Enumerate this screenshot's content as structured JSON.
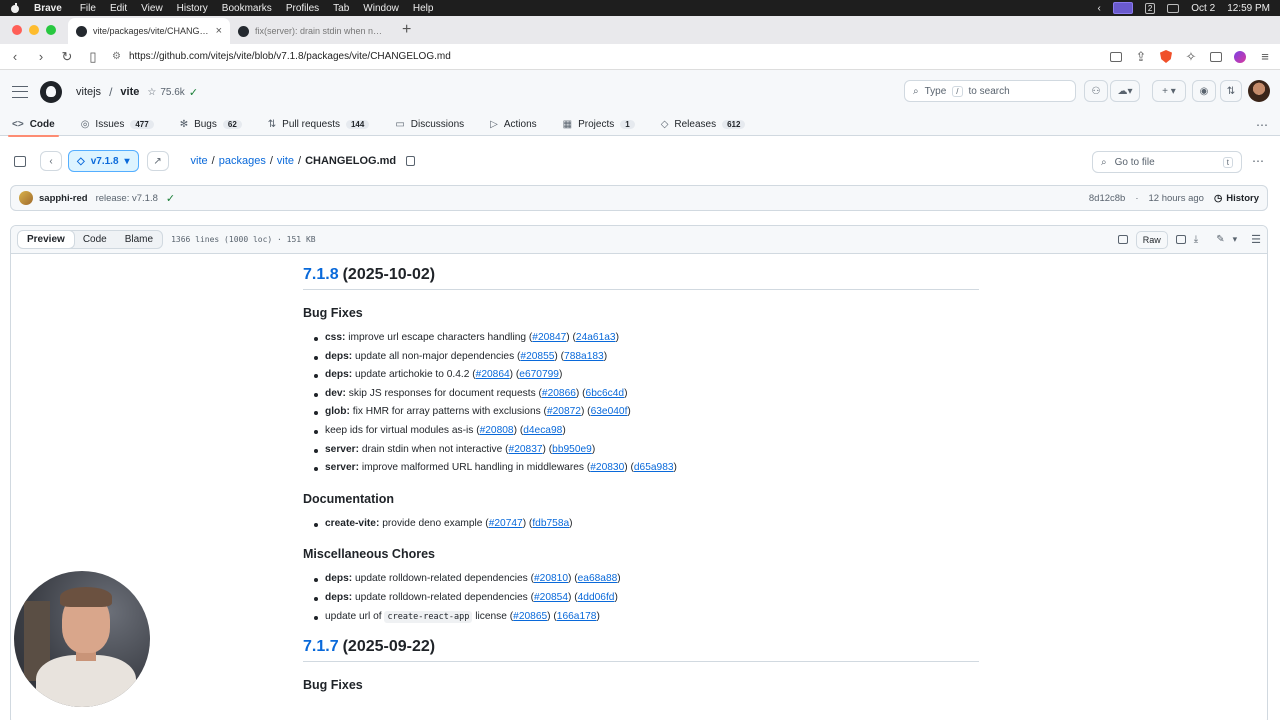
{
  "os": {
    "menubar": [
      "Brave",
      "File",
      "Edit",
      "View",
      "History",
      "Bookmarks",
      "Profiles",
      "Tab",
      "Window",
      "Help"
    ],
    "date": "Oct 2",
    "time": "12:59 PM",
    "desktop_number": "2"
  },
  "browser": {
    "tabs": [
      {
        "title": "vite/packages/vite/CHANGELOG.md"
      },
      {
        "title": "fix(server): drain stdin when not interactive"
      }
    ],
    "url": "https://github.com/vitejs/vite/blob/v7.1.8/packages/vite/CHANGELOG.md"
  },
  "github": {
    "owner": "vitejs",
    "repo": "vite",
    "stars": "75.6k",
    "search_placeholder_pre": "Type",
    "search_key": "/",
    "search_placeholder_post": "to search",
    "nav": [
      {
        "label": "Code",
        "count": ""
      },
      {
        "label": "Issues",
        "count": "477"
      },
      {
        "label": "Bugs",
        "count": "62"
      },
      {
        "label": "Pull requests",
        "count": "144"
      },
      {
        "label": "Discussions",
        "count": ""
      },
      {
        "label": "Actions",
        "count": ""
      },
      {
        "label": "Projects",
        "count": "1"
      },
      {
        "label": "Releases",
        "count": "612"
      }
    ],
    "branch": "v7.1.8",
    "path": [
      "vite",
      "packages",
      "vite"
    ],
    "filename": "CHANGELOG.md",
    "goto_placeholder": "Go to file",
    "goto_key": "t",
    "commit": {
      "author": "sapphi-red",
      "message": "release: v7.1.8",
      "sha": "8d12c8b",
      "when": "12 hours ago",
      "history_label": "History"
    },
    "view_tabs": [
      "Preview",
      "Code",
      "Blame"
    ],
    "file_meta": "1366 lines (1000 loc) · 151 KB",
    "raw_label": "Raw"
  },
  "changelog": {
    "r1_version": "7.1.8",
    "r1_date": "(2025-10-02)",
    "bug_fixes_heading": "Bug Fixes",
    "bug_fixes": [
      {
        "scope": "css:",
        "text": "improve url escape characters handling",
        "pr": "#20847",
        "sha": "24a61a3"
      },
      {
        "scope": "deps:",
        "text": "update all non-major dependencies",
        "pr": "#20855",
        "sha": "788a183"
      },
      {
        "scope": "deps:",
        "text": "update artichokie to 0.4.2",
        "pr": "#20864",
        "sha": "e670799"
      },
      {
        "scope": "dev:",
        "text": "skip JS responses for document requests",
        "pr": "#20866",
        "sha": "6bc6c4d"
      },
      {
        "scope": "glob:",
        "text": "fix HMR for array patterns with exclusions",
        "pr": "#20872",
        "sha": "63e040f"
      },
      {
        "scope": "",
        "text": "keep ids for virtual modules as-is",
        "pr": "#20808",
        "sha": "d4eca98"
      },
      {
        "scope": "server:",
        "text": "drain stdin when not interactive",
        "pr": "#20837",
        "sha": "bb950e9"
      },
      {
        "scope": "server:",
        "text": "improve malformed URL handling in middlewares",
        "pr": "#20830",
        "sha": "d65a983"
      }
    ],
    "docs_heading": "Documentation",
    "docs": [
      {
        "scope": "create-vite:",
        "text": "provide deno example",
        "pr": "#20747",
        "sha": "fdb758a"
      }
    ],
    "chores_heading": "Miscellaneous Chores",
    "chores": [
      {
        "scope": "deps:",
        "text": "update rolldown-related dependencies",
        "pr": "#20810",
        "sha": "ea68a88"
      },
      {
        "scope": "deps:",
        "text": "update rolldown-related dependencies",
        "pr": "#20854",
        "sha": "4dd06fd"
      },
      {
        "pre": "update url of",
        "code": "create-react-app",
        "post": "license",
        "pr": "#20865",
        "sha": "166a178"
      }
    ],
    "r2_version": "7.1.7",
    "r2_date": "(2025-09-22)",
    "r2_heading": "Bug Fixes"
  }
}
